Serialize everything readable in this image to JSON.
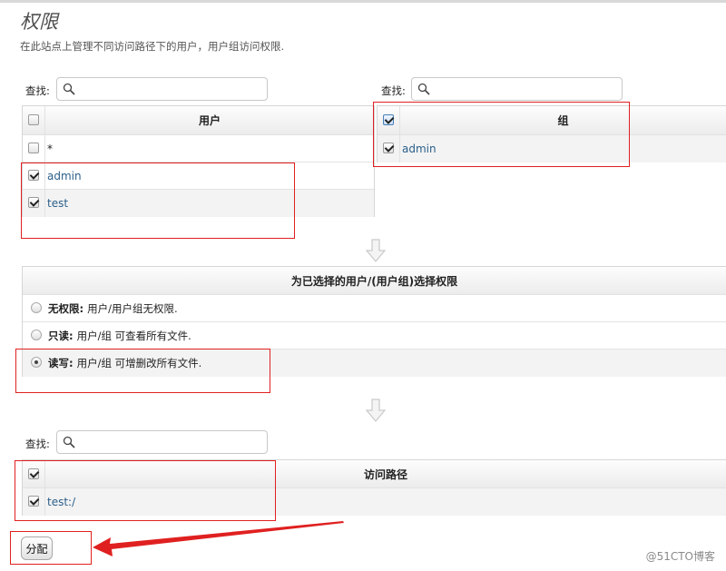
{
  "title": "权限",
  "description": "在此站点上管理不同访问路径下的用户，用户组访问权限.",
  "search_label": "查找:",
  "users": {
    "header": "用户",
    "rows": [
      {
        "label": "*",
        "checked": false
      },
      {
        "label": "admin",
        "checked": true
      },
      {
        "label": "test",
        "checked": true
      }
    ]
  },
  "groups": {
    "header": "组",
    "rows": [
      {
        "label": "admin",
        "checked": true
      }
    ]
  },
  "permissions": {
    "header": "为已选择的用户/(用户组)选择权限",
    "options": [
      {
        "title": "无权限:",
        "desc": "用户/用户组无权限.",
        "selected": false
      },
      {
        "title": "只读:",
        "desc": "用户/组 可查看所有文件.",
        "selected": false
      },
      {
        "title": "读写:",
        "desc": "用户/组 可增删改所有文件.",
        "selected": true
      }
    ]
  },
  "paths": {
    "header": "访问路径",
    "rows": [
      {
        "label": "test:/",
        "checked": true
      }
    ]
  },
  "assign_button": "分配",
  "watermark": "@51CTO博客",
  "colors": {
    "annotation": "#e02020",
    "link": "#2b5f8a"
  },
  "icons": [
    "search-icon",
    "down-arrow-icon",
    "annotation-arrow-icon"
  ]
}
